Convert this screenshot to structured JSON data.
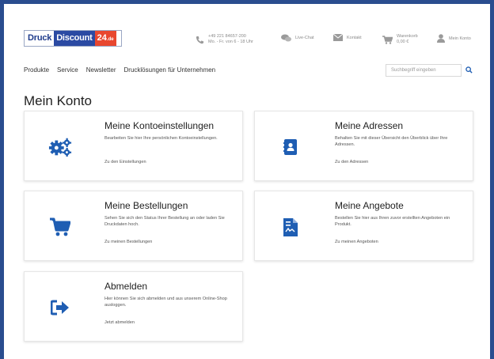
{
  "logo": {
    "part1": "Druck",
    "part2": "Discount",
    "part3": "24",
    "tld": ".de"
  },
  "header": {
    "phone_number": "+49 221 84657-200",
    "phone_hours": "Mo. - Fr. von 6 - 18 Uhr",
    "live_chat": "Live-Chat",
    "contact": "Kontakt",
    "cart_label": "Warenkorb",
    "cart_total": "0,00 €",
    "account": "Mein Konto"
  },
  "nav": {
    "items": [
      "Produkte",
      "Service",
      "Newsletter",
      "Drucklösungen für Unternehmen"
    ]
  },
  "search": {
    "placeholder": "Suchbegriff eingeben"
  },
  "page": {
    "title": "Mein Konto"
  },
  "colors": {
    "icon_blue": "#1f5eb3",
    "frame": "#2a4d8f",
    "logo_red": "#e8472f",
    "logo_blue": "#2b4aa3"
  },
  "cards": [
    {
      "title": "Meine Kontoeinstellungen",
      "description": "Bearbeiten Sie hier Ihre persönlichen Kontoeinstellungen.",
      "link": "Zu den Einstellungen",
      "icon": "gears-icon"
    },
    {
      "title": "Meine Adressen",
      "description": "Behalten Sie mit dieser Übersicht den Überblick über Ihre Adressen.",
      "link": "Zu den Adressen",
      "icon": "address-book-icon"
    },
    {
      "title": "Meine Bestellungen",
      "description": "Sehen Sie sich den Status Ihrer Bestellung an oder laden Sie Druckdaten hoch.",
      "link": "Zu meinen Bestellungen",
      "icon": "cart-icon"
    },
    {
      "title": "Meine Angebote",
      "description": "Bestellen Sie hier aus Ihren zuvor erstellten Angeboten ein Produkt.",
      "link": "Zu meinen Angeboten",
      "icon": "document-icon"
    },
    {
      "title": "Abmelden",
      "description": "Hier können Sie sich abmelden und aus unserem Online-Shop ausloggen.",
      "link": "Jetzt abmelden",
      "icon": "sign-out-icon"
    }
  ]
}
